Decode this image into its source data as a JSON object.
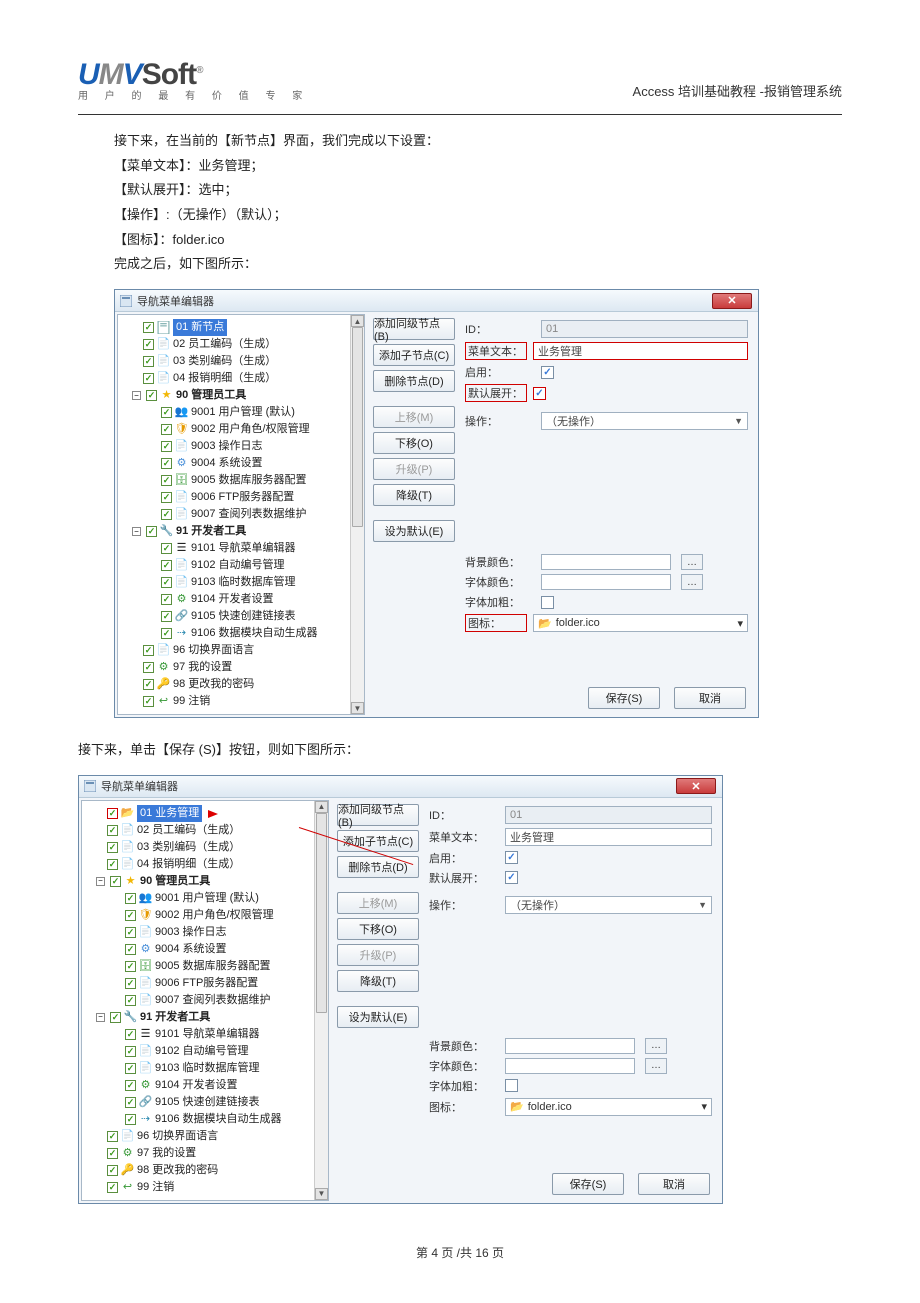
{
  "header": {
    "logo_tagline": "用 户 的 最 有 价 值 专 家",
    "doc_title": "Access 培训基础教程  -报销管理系统"
  },
  "intro": [
    "接下来，在当前的【新节点】界面，我们完成以下设置：",
    "【菜单文本】：业务管理；",
    "【默认展开】：选中；",
    "【操作】:（无操作）（默认）；",
    "【图标】：folder.ico",
    "完成之后，如下图所示："
  ],
  "mid_text": "接下来，单击【保存  (S)】按钮，则如下图所示：",
  "dialog": {
    "title": "导航菜单编辑器",
    "buttons": {
      "add_sibling": "添加同级节点(B)",
      "add_child": "添加子节点(C)",
      "delete": "删除节点(D)",
      "move_up": "上移(M)",
      "move_down": "下移(O)",
      "promote": "升级(P)",
      "demote": "降级(T)",
      "set_default": "设为默认(E)"
    },
    "tree_a": {
      "selected": "01 新节点",
      "items": [
        "02 员工编码（生成）",
        "03 类别编码（生成）",
        "04 报销明细（生成）"
      ],
      "g90_label": "90 管理员工具",
      "g90": [
        "9001 用户管理 (默认)",
        "9002 用户角色/权限管理",
        "9003 操作日志",
        "9004 系统设置",
        "9005 数据库服务器配置",
        "9006 FTP服务器配置",
        "9007 查阅列表数据维护"
      ],
      "g91_label": "91 开发者工具",
      "g91": [
        "9101 导航菜单编辑器",
        "9102 自动编号管理",
        "9103 临时数据库管理",
        "9104 开发者设置",
        "9105 快速创建链接表",
        "9106 数据模块自动生成器"
      ],
      "tail": [
        "96 切换界面语言",
        "97 我的设置",
        "98 更改我的密码",
        "99 注销"
      ]
    },
    "tree_b": {
      "selected": "01 业务管理"
    },
    "form": {
      "id_label": "ID：",
      "id_value": "01",
      "menu_text_label": "菜单文本：",
      "menu_text_value": "业务管理",
      "enable_label": "启用：",
      "expand_label": "默认展开：",
      "action_label": "操作：",
      "action_value": "（无操作）",
      "bgcolor_label": "背景颜色：",
      "fontcolor_label": "字体颜色：",
      "bold_label": "字体加粗：",
      "icon_label": "图标：",
      "icon_value": "folder.ico",
      "save": "保存(S)",
      "cancel": "取消"
    }
  },
  "footer": {
    "page": "第 4 页 /共 16 页"
  }
}
